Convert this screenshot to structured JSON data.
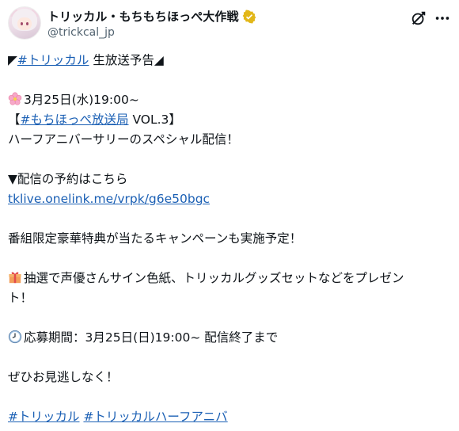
{
  "account": {
    "display_name": "トリッカル・もちもちほっぺ大作戦",
    "handle": "@trickcal_jp"
  },
  "icons": {
    "verified": "verified-badge-icon",
    "grok": "grok-icon",
    "more": "more-options-icon"
  },
  "post": {
    "l1_prefix": "◤",
    "l1_hashtag": "#トリッカル",
    "l1_suffix": " 生放送予告◢",
    "l2_text": "3月25日(水)19:00~",
    "l3_prefix": "【",
    "l3_hashtag": "#もちほっぺ放送局",
    "l3_suffix": " VOL.3】",
    "l4_text": "ハーフアニバーサリーのスペシャル配信！",
    "l5_text": "▼配信の予約はこちら",
    "l6_link": "tklive.onelink.me/vrpk/g6e50bgc",
    "l7_text": "番組限定豪華特典が当たるキャンペーンも実施予定！",
    "l8_text": "抽選で声優さんサイン色紙、トリッカルグッズセットなどをプレゼン",
    "l9_text": "ト！",
    "l10_text": "応募期間：3月25日(日)19:00~ 配信終了まで",
    "l11_text": "ぜひお見逃しなく！",
    "tag1": "#トリッカル",
    "tag2": "#トリッカルハーフアニバ"
  },
  "colors": {
    "link": "#1a5fb4",
    "verified_badge": "#e2b719",
    "secondary_text": "#536471"
  }
}
